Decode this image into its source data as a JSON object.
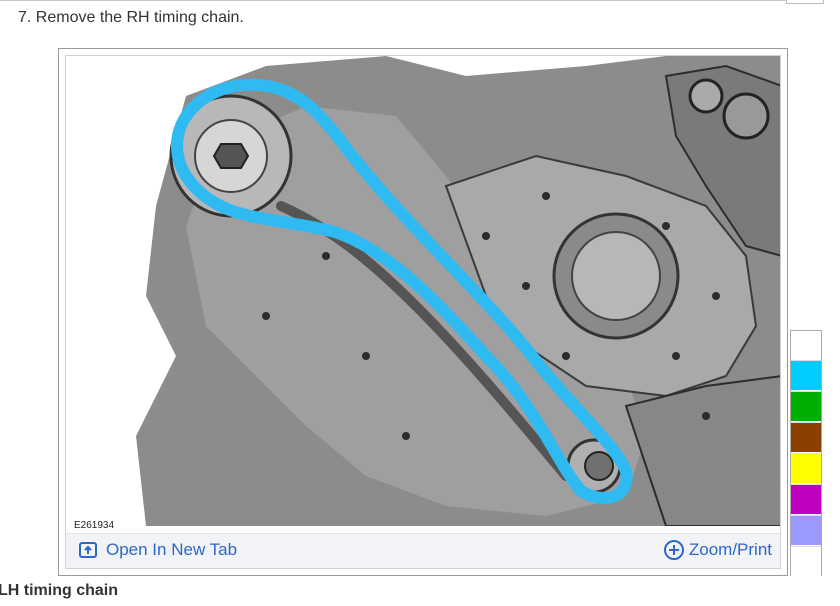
{
  "step": {
    "text": "7. Remove the RH timing chain."
  },
  "figure": {
    "id_label": "E261934",
    "open_label": "Open In New Tab",
    "zoom_label": "Zoom/Print",
    "chain_color": "#2fbaf2"
  },
  "palette": {
    "colors": [
      "#ffffff",
      "#00ccff",
      "#00b000",
      "#8b4000",
      "#ffff00",
      "#c000c0",
      "#9999ff",
      "#ffffff"
    ]
  },
  "next_section": {
    "heading": "LH timing chain"
  }
}
